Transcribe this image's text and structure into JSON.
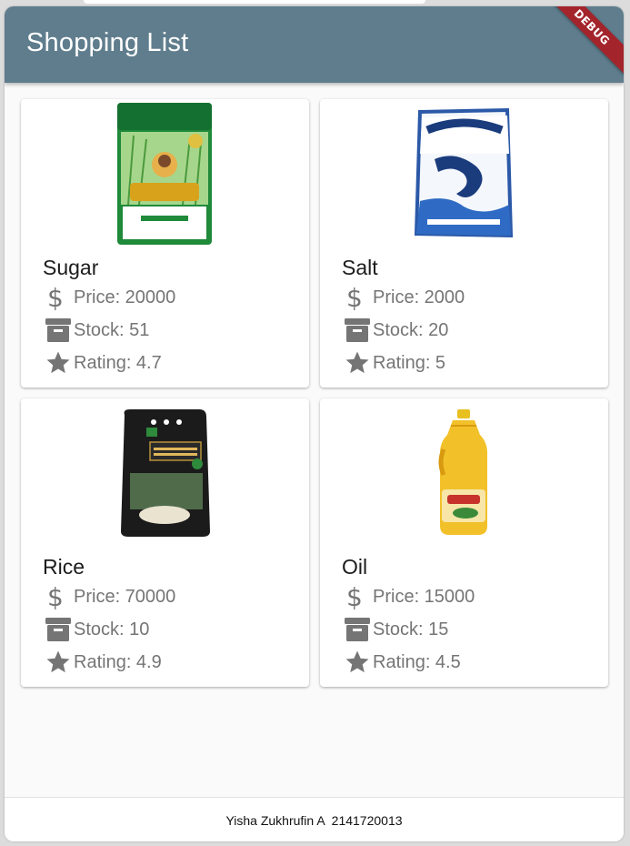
{
  "appbar": {
    "title": "Shopping List",
    "debug_label": "DEBUG"
  },
  "colors": {
    "appbar": "#5f7d8d",
    "debug_banner": "#a3242b",
    "icon_gray": "#757575"
  },
  "products": [
    {
      "name": "Sugar",
      "price_label": "Price:  20000",
      "stock_label": "Stock: 51",
      "rating_label": "Rating: 4.7",
      "image_icon": "sugar-package-icon",
      "package_text": "GULAKU"
    },
    {
      "name": "Salt",
      "price_label": "Price:  2000",
      "stock_label": "Stock: 20",
      "rating_label": "Rating: 5",
      "image_icon": "salt-package-icon",
      "package_text": "DOLPIN"
    },
    {
      "name": "Rice",
      "price_label": "Price:  70000",
      "stock_label": "Stock: 10",
      "rating_label": "Rating: 4.9",
      "image_icon": "rice-bag-icon",
      "package_text": "SINTANUR WANGI"
    },
    {
      "name": "Oil",
      "price_label": "Price:  15000",
      "stock_label": "Stock: 15",
      "rating_label": "Rating: 4.5",
      "image_icon": "oil-bottle-icon",
      "package_text": "Bimoli"
    }
  ],
  "icons": {
    "price": "dollar-icon",
    "stock": "archive-box-icon",
    "rating": "star-icon"
  },
  "footer": {
    "text": "Yisha Zukhrufin A  2141720013"
  }
}
